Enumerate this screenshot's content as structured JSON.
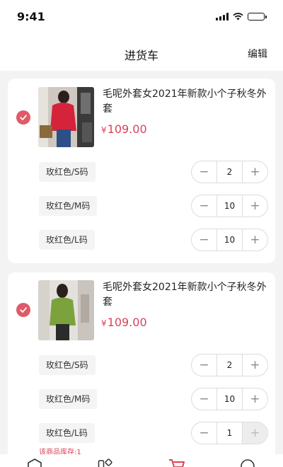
{
  "status_bar": {
    "time": "9:41"
  },
  "nav": {
    "title": "进货车",
    "edit_label": "编辑"
  },
  "cart": {
    "items": [
      {
        "title": "毛呢外套女2021年新款小个子秋冬外套",
        "currency": "¥",
        "price": "109.00",
        "variants": [
          {
            "label": "玫红色/S码",
            "qty": "2"
          },
          {
            "label": "玫红色/M码",
            "qty": "10"
          },
          {
            "label": "玫红色/L码",
            "qty": "10"
          }
        ]
      },
      {
        "title": "毛呢外套女2021年新款小个子秋冬外套",
        "currency": "¥",
        "price": "109.00",
        "variants": [
          {
            "label": "玫红色/S码",
            "qty": "2"
          },
          {
            "label": "玫红色/M码",
            "qty": "10"
          },
          {
            "label": "玫红色/L码",
            "qty": "1"
          }
        ],
        "stock_warning": "该商品库存:1"
      }
    ]
  },
  "stepper": {
    "minus": "−",
    "plus": "+"
  },
  "colors": {
    "accent": "#e05a67",
    "price": "#d9435a"
  },
  "tab_bar": {
    "icons": [
      "home-icon",
      "category-icon",
      "cart-icon",
      "profile-icon"
    ]
  }
}
